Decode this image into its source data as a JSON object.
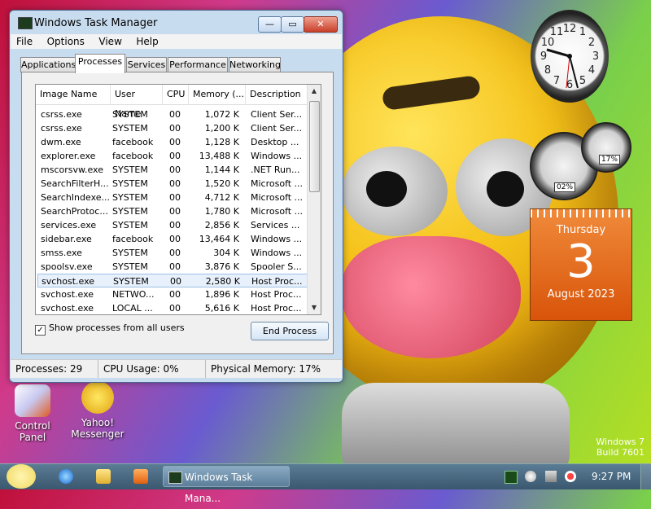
{
  "window": {
    "title": "Windows Task Manager",
    "controls": {
      "min": "—",
      "max": "▭",
      "close": "✕"
    },
    "menu": [
      "File",
      "Options",
      "View",
      "Help"
    ],
    "tabs": [
      "Applications",
      "Processes",
      "Services",
      "Performance",
      "Networking"
    ],
    "active_tab": "Processes",
    "columns": [
      "Image Name",
      "User Name",
      "CPU",
      "Memory (...",
      "Description"
    ],
    "rows": [
      [
        "csrss.exe",
        "SYSTEM",
        "00",
        "1,072 K",
        "Client Ser..."
      ],
      [
        "csrss.exe",
        "SYSTEM",
        "00",
        "1,200 K",
        "Client Ser..."
      ],
      [
        "dwm.exe",
        "facebook",
        "00",
        "1,128 K",
        "Desktop ..."
      ],
      [
        "explorer.exe",
        "facebook",
        "00",
        "13,488 K",
        "Windows ..."
      ],
      [
        "mscorsvw.exe",
        "SYSTEM",
        "00",
        "1,144 K",
        ".NET Run..."
      ],
      [
        "SearchFilterH...",
        "SYSTEM",
        "00",
        "1,520 K",
        "Microsoft ..."
      ],
      [
        "SearchIndexe...",
        "SYSTEM",
        "00",
        "4,712 K",
        "Microsoft ..."
      ],
      [
        "SearchProtoc...",
        "SYSTEM",
        "00",
        "1,780 K",
        "Microsoft ..."
      ],
      [
        "services.exe",
        "SYSTEM",
        "00",
        "2,856 K",
        "Services ..."
      ],
      [
        "sidebar.exe",
        "facebook",
        "00",
        "13,464 K",
        "Windows ..."
      ],
      [
        "smss.exe",
        "SYSTEM",
        "00",
        "304 K",
        "Windows ..."
      ],
      [
        "spoolsv.exe",
        "SYSTEM",
        "00",
        "3,876 K",
        "Spooler S..."
      ],
      [
        "svchost.exe",
        "SYSTEM",
        "00",
        "2,580 K",
        "Host Proc..."
      ],
      [
        "svchost.exe",
        "NETWO...",
        "00",
        "1,896 K",
        "Host Proc..."
      ],
      [
        "svchost.exe",
        "LOCAL ...",
        "00",
        "5,616 K",
        "Host Proc..."
      ]
    ],
    "selected_row": 12,
    "show_all_label": "Show processes from all users",
    "show_all_checked": "✓",
    "end_process_label": "End Process",
    "status": {
      "processes": "Processes: 29",
      "cpu": "CPU Usage: 0%",
      "memory": "Physical Memory: 17%"
    }
  },
  "gadgets": {
    "clock_numbers": [
      "12",
      "1",
      "2",
      "3",
      "4",
      "5",
      "6",
      "7",
      "8",
      "9",
      "10",
      "11"
    ],
    "cpu_meter": "02%",
    "mem_meter": "17%",
    "calendar": {
      "day": "Thursday",
      "date": "3",
      "month": "August 2023"
    }
  },
  "desktop_icons": [
    {
      "label": "Control Panel"
    },
    {
      "label": "Yahoo!\nMessenger",
      "line1": "Yahoo!",
      "line2": "Messenger"
    }
  ],
  "watermark": {
    "line1": "Windows 7",
    "line2": "Build 7601"
  },
  "taskbar": {
    "task_label": "Windows Task Mana...",
    "time": "9:27 PM"
  },
  "colors": {
    "accent": "#3a5870",
    "calendar": "#e8661a",
    "selection": "#e7f0fb"
  }
}
